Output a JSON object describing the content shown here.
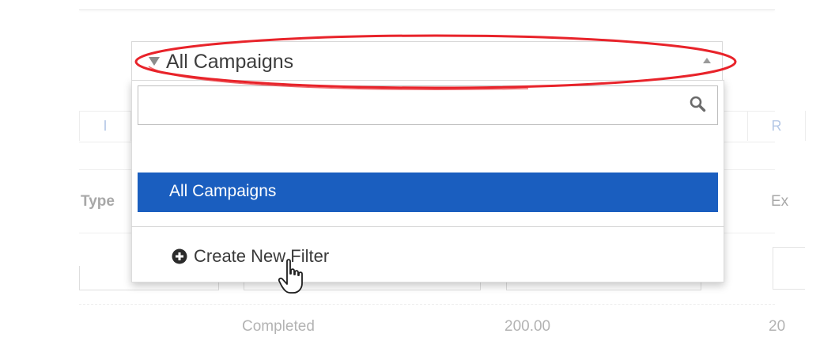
{
  "background": {
    "tab_left_partial": "I",
    "tab_right_partial": "R",
    "col_type_label": "Type",
    "col_exp_partial": "Ex",
    "row_status": "Completed",
    "row_amount": "200.00",
    "row_amount_partial": "20"
  },
  "select": {
    "value": "All Campaigns",
    "search_placeholder": "",
    "options": [
      {
        "label": "All Campaigns",
        "selected": true
      }
    ],
    "create_filter_label": "Create New Filter"
  },
  "colors": {
    "selected_option_bg": "#1a5ebf",
    "highlight_ellipse": "#e8232a"
  },
  "icons": {
    "caret": "caret-down-icon",
    "arrow_up": "arrow-up-icon",
    "search": "search-icon",
    "plus": "plus-circle-icon",
    "cursor": "hand-cursor-icon"
  }
}
